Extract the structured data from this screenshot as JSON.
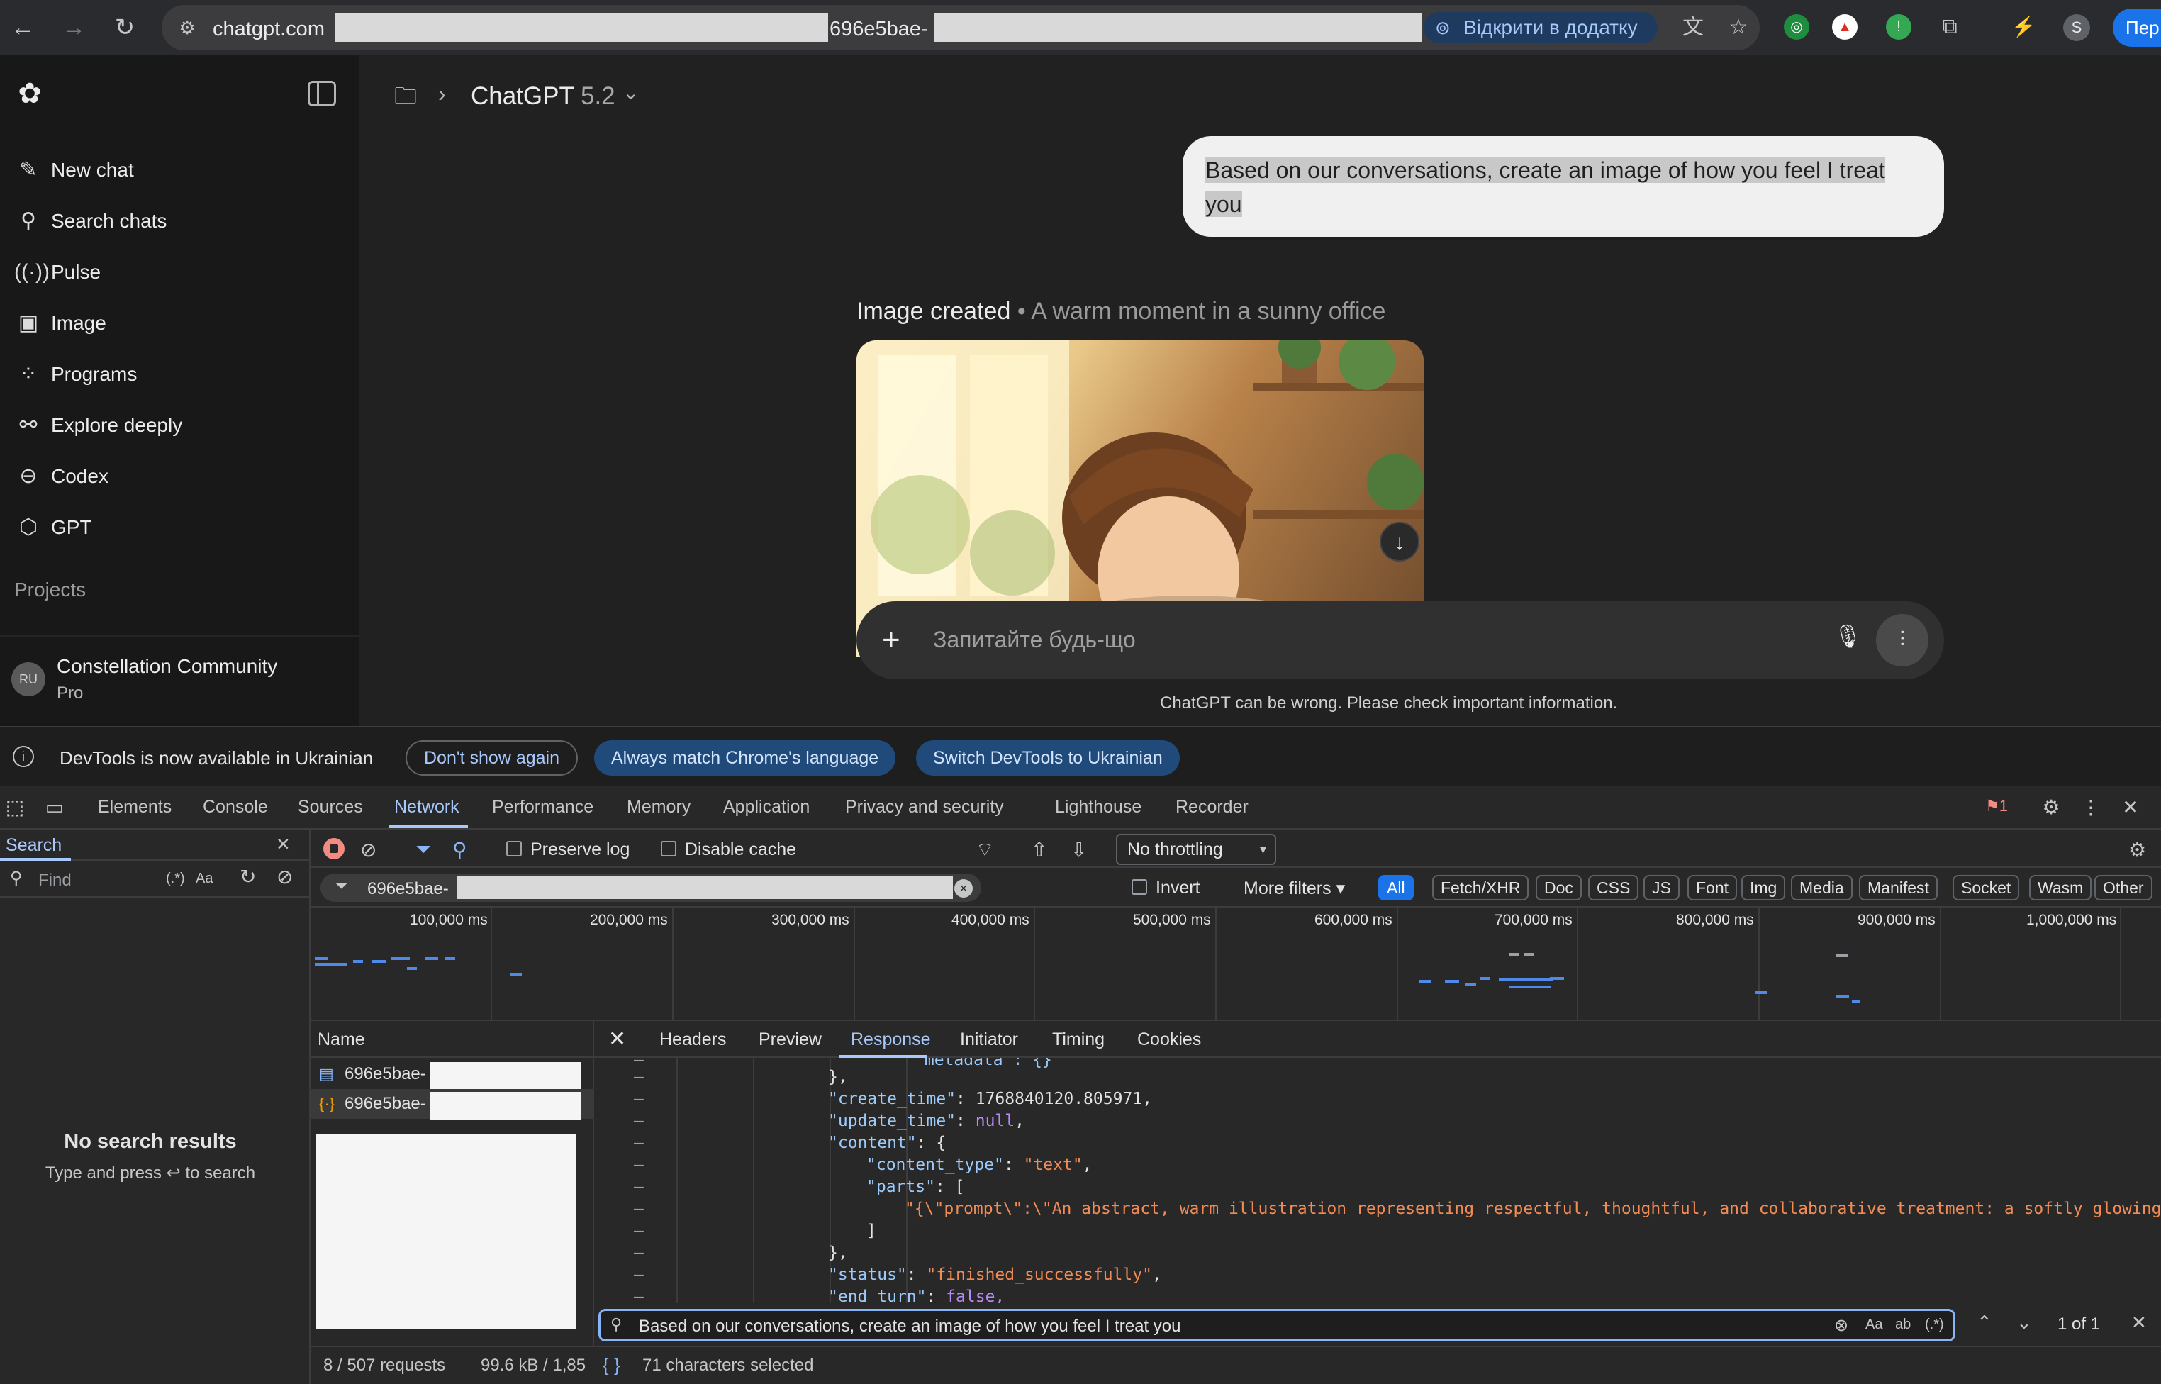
{
  "browser": {
    "url_host": "chatgpt.com",
    "url_fragment": "696e5bae-",
    "open_in_app": "Відкрити в додатку",
    "translate_partial": "Пер",
    "profile_initial": "S"
  },
  "sidebar": {
    "items": [
      {
        "label": "New chat",
        "icon": "compose-icon"
      },
      {
        "label": "Search chats",
        "icon": "search-icon"
      },
      {
        "label": "Pulse",
        "icon": "pulse-icon"
      },
      {
        "label": "Image",
        "icon": "image-icon"
      },
      {
        "label": "Programs",
        "icon": "grid-icon"
      },
      {
        "label": "Explore deeply",
        "icon": "telescope-icon"
      },
      {
        "label": "Codex",
        "icon": "codex-icon"
      },
      {
        "label": "GPT",
        "icon": "cube-icon"
      }
    ],
    "projects_label": "Projects",
    "user": {
      "initials": "RU",
      "name": "Constellation Community",
      "plan": "Pro"
    }
  },
  "main": {
    "model_name": "ChatGPT",
    "model_version": "5.2",
    "user_message": "Based on our conversations, create an image of how you feel I treat you",
    "image_created_label": "Image created",
    "image_caption": "A warm moment in a sunny office",
    "composer_placeholder": "Запитайте будь-що",
    "disclaimer": "ChatGPT can be wrong. Please check important information."
  },
  "devtools": {
    "banner": {
      "message": "DevTools is now available in Ukrainian",
      "dont_show": "Don't show again",
      "always_match": "Always match Chrome's language",
      "switch_ukrainian": "Switch DevTools to Ukrainian"
    },
    "tabs": [
      "Elements",
      "Console",
      "Sources",
      "Network",
      "Performance",
      "Memory",
      "Application",
      "Privacy and security",
      "Lighthouse",
      "Recorder"
    ],
    "active_tab": "Network",
    "issues_count": "1",
    "search_pane": {
      "title": "Search",
      "find_placeholder": "Find",
      "regex_opt": "(.*)",
      "case_opt": "Aa",
      "no_results": "No search results",
      "hint": "Type and press ↩ to search"
    },
    "toolbar": {
      "preserve_log": "Preserve log",
      "disable_cache": "Disable cache",
      "throttling": "No throttling"
    },
    "filter": {
      "value": "696e5bae-",
      "invert": "Invert",
      "more_filters": "More filters",
      "chips": [
        "All",
        "Fetch/XHR",
        "Doc",
        "CSS",
        "JS",
        "Font",
        "Img",
        "Media",
        "Manifest",
        "Socket",
        "Wasm",
        "Other"
      ]
    },
    "overview_ticks": [
      "100,000 ms",
      "200,000 ms",
      "300,000 ms",
      "400,000 ms",
      "500,000 ms",
      "600,000 ms",
      "700,000 ms",
      "800,000 ms",
      "900,000 ms",
      "1,000,000 ms"
    ],
    "requests_header": "Name",
    "requests": [
      {
        "name": "696e5bae-",
        "type": "doc"
      },
      {
        "name": "696e5bae-",
        "type": "json"
      }
    ],
    "detail_tabs": [
      "Headers",
      "Preview",
      "Response",
      "Initiator",
      "Timing",
      "Cookies"
    ],
    "active_detail_tab": "Response",
    "code": {
      "l1": "\"metadata\": {}",
      "l2": "},",
      "l3k": "\"create_time\"",
      "l3v": "1768840120.805971,",
      "l4k": "\"update_time\"",
      "l4v": "null",
      "l5k": "\"content\"",
      "l5v": ": {",
      "l6k": "\"content_type\"",
      "l6v": "\"text\"",
      "l7k": "\"parts\"",
      "l7v": ": [",
      "l8": "\"{\\\"prompt\\\":\\\"An abstract, warm illustration representing respectful, thoughtful, and collaborative treatment: a softly glowing works",
      "l9": "]",
      "l10": "},",
      "l11k": "\"status\"",
      "l11v": "\"finished_successfully\"",
      "l12k": "\"end_turn\"",
      "l12v": "false,"
    },
    "find_query": "Based on our conversations, create an image of how you feel I treat you",
    "find_count": "1 of 1",
    "status_requests": "8 / 507 requests",
    "status_transfer": "99.6 kB / 1,85",
    "status_selected": "71 characters selected",
    "braces_label": "{ }"
  }
}
